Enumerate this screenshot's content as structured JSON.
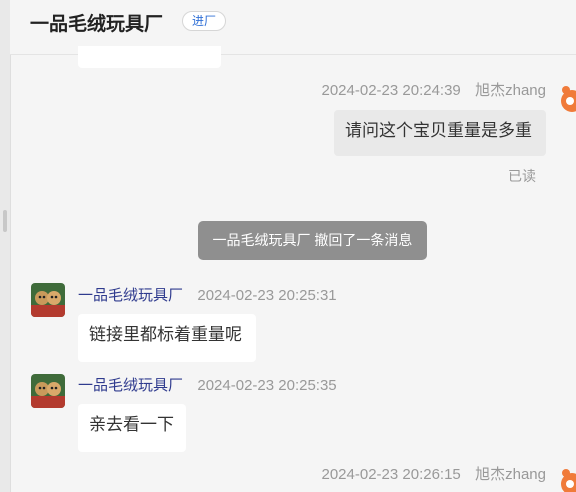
{
  "header": {
    "title": "一品毛绒玩具厂",
    "tag": "进厂"
  },
  "messages": [
    {
      "time": "2024-02-23 20:24:39",
      "sender": "旭杰zhang",
      "text": "请问这个宝贝重量是多重",
      "status": "已读"
    },
    {
      "recall": "一品毛绒玩具厂 撤回了一条消息"
    },
    {
      "sender": "一品毛绒玩具厂",
      "time": "2024-02-23 20:25:31",
      "text": "链接里都标着重量呢"
    },
    {
      "sender": "一品毛绒玩具厂",
      "time": "2024-02-23 20:25:35",
      "text": "亲去看一下"
    },
    {
      "time": "2024-02-23 20:26:15",
      "sender": "旭杰zhang"
    }
  ],
  "icons": {
    "shop_avatar": "plush-toys-avatar",
    "user_avatar": "orange-cartoon-avatar"
  }
}
